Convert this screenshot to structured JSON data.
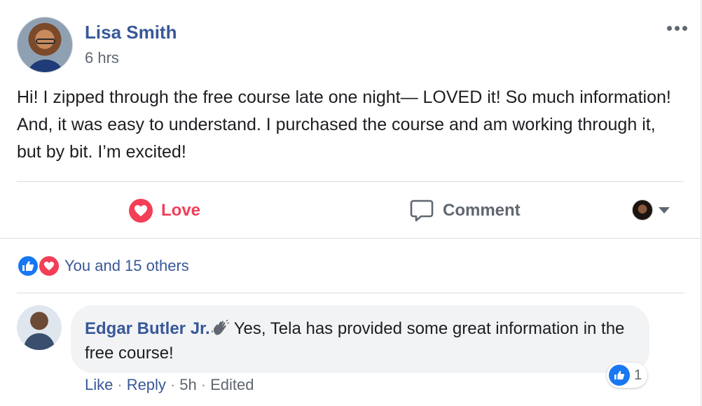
{
  "post": {
    "author": "Lisa Smith",
    "time": "6 hrs",
    "text": "Hi! I zipped through the free course late one night— LOVED it! So much information! And, it was easy to understand. I purchased the course and am working through it, but by bit. I’m excited!"
  },
  "actions": {
    "love_label": "Love",
    "comment_label": "Comment"
  },
  "reactions": {
    "summary": "You and 15 others",
    "icons": [
      "like-icon",
      "love-icon"
    ]
  },
  "comment": {
    "author": "Edgar Butler Jr.",
    "text": "Yes, Tela has provided some great information in the free course!",
    "reaction_count": "1",
    "like_label": "Like",
    "reply_label": "Reply",
    "time": "5h",
    "edited_label": "Edited",
    "separator": "·"
  },
  "colors": {
    "link": "#385898",
    "love": "#f33e58",
    "like": "#1877f2",
    "muted": "#606770"
  }
}
